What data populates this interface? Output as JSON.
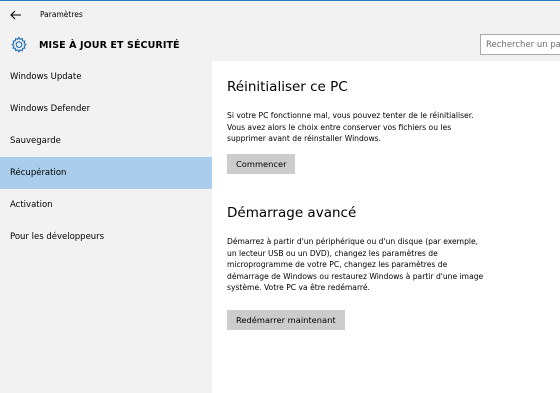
{
  "window": {
    "app_title": "Paramètres"
  },
  "header": {
    "title": "MISE À JOUR ET SÉCURITÉ",
    "search_placeholder": "Rechercher un paramètre",
    "icon": "gear-icon"
  },
  "sidebar": {
    "items": [
      {
        "label": "Windows Update",
        "selected": false
      },
      {
        "label": "Windows Defender",
        "selected": false
      },
      {
        "label": "Sauvegarde",
        "selected": false
      },
      {
        "label": "Récupération",
        "selected": true
      },
      {
        "label": "Activation",
        "selected": false
      },
      {
        "label": "Pour les développeurs",
        "selected": false
      }
    ]
  },
  "main": {
    "reset": {
      "title": "Réinitialiser ce PC",
      "lines": [
        "Si votre PC fonctionne mal, vous pouvez tenter de le réinitialiser.",
        "Vous avez alors le choix entre conserver vos fichiers ou les",
        "supprimer avant de réinstaller Windows."
      ],
      "button": "Commencer"
    },
    "advanced": {
      "title": "Démarrage avancé",
      "lines": [
        "Démarrez à partir d'un périphérique ou d'un disque (par exemple,",
        "un lecteur USB ou un DVD), changez les paramètres de",
        "microprogramme de votre PC, changez les paramètres de",
        "démarrage de Windows ou restaurez Windows à partir d'une image",
        "système. Votre PC va être redémarré."
      ],
      "button": "Redémarrer maintenant"
    }
  },
  "colors": {
    "selected_bg": "#a9cdea",
    "chrome_bg": "#f2f2f2",
    "accent_border": "#2b79c2",
    "button_bg": "#cccccc"
  }
}
